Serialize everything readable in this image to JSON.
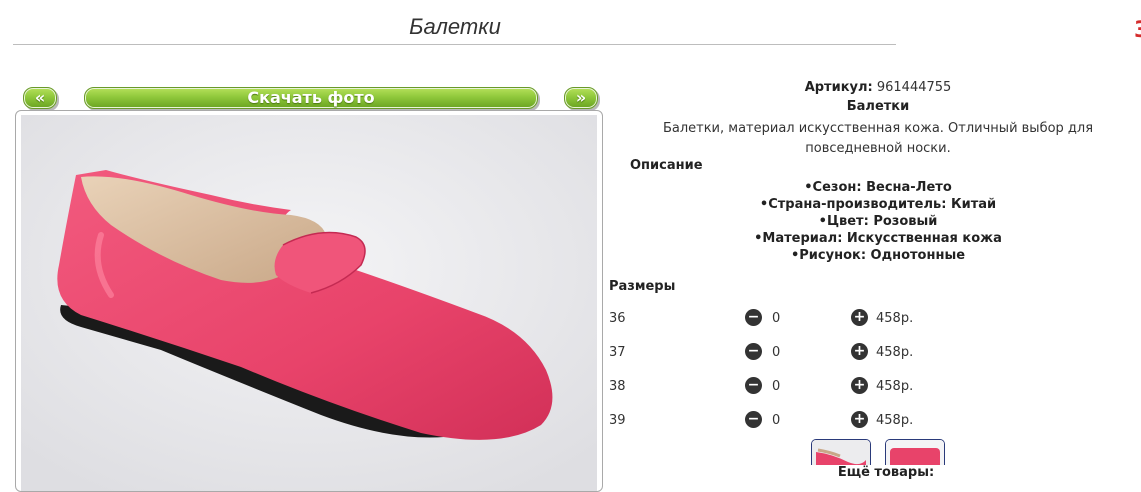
{
  "page": {
    "title": "Балетки"
  },
  "gallery": {
    "prev_label": "«",
    "download_label": "Скачать фото",
    "next_label": "»"
  },
  "product": {
    "sku_label": "Артикул:",
    "sku_value": "961444755",
    "name": "Балетки",
    "description": "Балетки, материал искусственная кожа. Отличный выбор для повседневной носки.",
    "description_heading": "Описание",
    "features": [
      "Сезон: Весна-Лето",
      "Страна-производитель: Китай",
      "Цвет: Розовый",
      "Материал: Искусственная кожа",
      "Рисунок: Однотонные"
    ],
    "shoe_color": "#e8436a"
  },
  "sizes": {
    "heading": "Размеры",
    "rows": [
      {
        "size": "36",
        "qty": "0",
        "price": "458р."
      },
      {
        "size": "37",
        "qty": "0",
        "price": "458р."
      },
      {
        "size": "38",
        "qty": "0",
        "price": "458р."
      },
      {
        "size": "39",
        "qty": "0",
        "price": "458р."
      }
    ],
    "minus_icon": "minus-circle-icon",
    "plus_icon": "plus-circle-icon"
  },
  "more": {
    "label": "Ещё товары:"
  }
}
